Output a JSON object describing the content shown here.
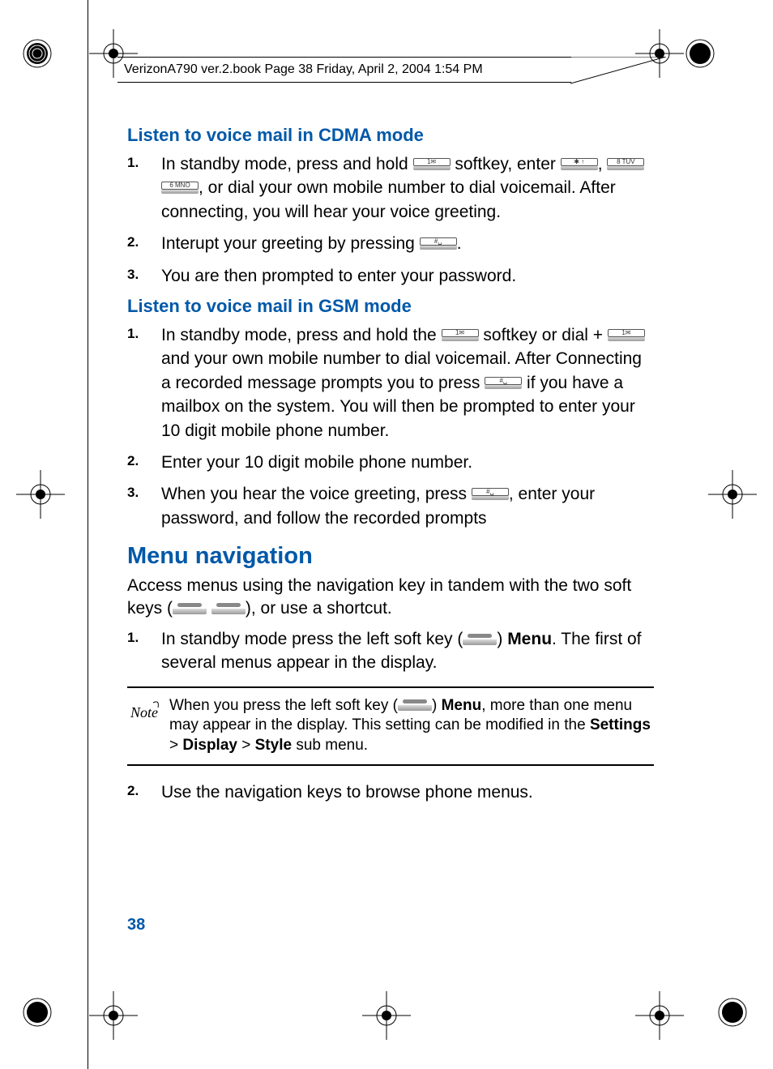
{
  "header": "VerizonA790 ver.2.book  Page 38  Friday, April 2, 2004  1:54 PM",
  "section1_title": "Listen to voice mail in CDMA mode",
  "s1_items": [
    {
      "n": "1.",
      "t": {
        "a": "In standby mode, press and hold ",
        "b": " softkey, enter ",
        "c": ", ",
        "d": " ",
        "e": ", or dial your own mobile number to dial voicemail. After connecting, you will hear your voice greeting."
      }
    },
    {
      "n": "2.",
      "t": {
        "a": "Interupt your greeting by pressing ",
        "b": "."
      }
    },
    {
      "n": "3.",
      "t": {
        "a": "You are then prompted to enter your password."
      }
    }
  ],
  "section2_title": "Listen to voice mail in GSM mode",
  "s2_items": [
    {
      "n": "1.",
      "t": {
        "a": "In standby mode, press and hold the ",
        "b": " softkey or dial +  ",
        "c": " and your own mobile number to dial voicemail. After Connecting a recorded message prompts you to press ",
        "d": " if you have a mailbox on the system. You will then be prompted to enter your 10 digit mobile phone number."
      }
    },
    {
      "n": "2.",
      "t": {
        "a": "Enter your 10 digit mobile phone number."
      }
    },
    {
      "n": "3.",
      "t": {
        "a": "When you hear the voice greeting, press ",
        "b": ", enter your password, and follow the recorded prompts"
      }
    }
  ],
  "menu_title": "Menu navigation",
  "menu_intro": {
    "a": "Access menus using the navigation key in tandem with the two soft keys (",
    "b": "  ",
    "c": "), or use a shortcut."
  },
  "menu_items": [
    {
      "n": "1.",
      "t": {
        "a": "In standby mode press the left soft key (",
        "b": ") ",
        "menu": "Menu",
        "c": ". The first of several menus appear in the display."
      }
    },
    {
      "n": "2.",
      "t": {
        "a": "Use the navigation keys to browse phone menus."
      }
    }
  ],
  "note": {
    "a": "When you press the left soft key (",
    "b": ") ",
    "menu": "Menu",
    "c": ", more than one menu may appear in the display. This setting can be modified in the ",
    "settings": "Settings",
    "gt1": " > ",
    "display": "Display",
    "gt2": " > ",
    "style": "Style",
    "d": " sub menu."
  },
  "note_label": "Note",
  "page_number": "38",
  "keys": {
    "k1": "1✉",
    "kstar": "✱ ↑",
    "k8": "8 TUV",
    "k6": "6 MNO",
    "khash": "#␣"
  }
}
